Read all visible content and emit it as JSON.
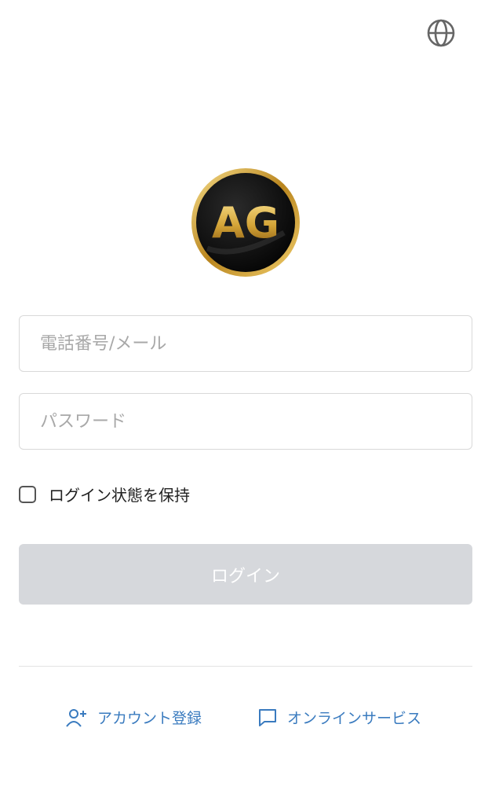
{
  "header": {
    "language_icon": "globe-icon"
  },
  "logo": {
    "text": "AG"
  },
  "form": {
    "phone_placeholder": "電話番号/メール",
    "password_placeholder": "パスワード",
    "remember_label": "ログイン状態を保持",
    "remember_checked": false,
    "login_label": "ログイン"
  },
  "footer": {
    "register_label": "アカウント登録",
    "register_icon": "add-user-icon",
    "support_label": "オンラインサービス",
    "support_icon": "chat-bubble-icon"
  },
  "colors": {
    "link": "#3a7bbf",
    "button_disabled": "#d6d8dc",
    "logo_gold": "#d4a437"
  }
}
